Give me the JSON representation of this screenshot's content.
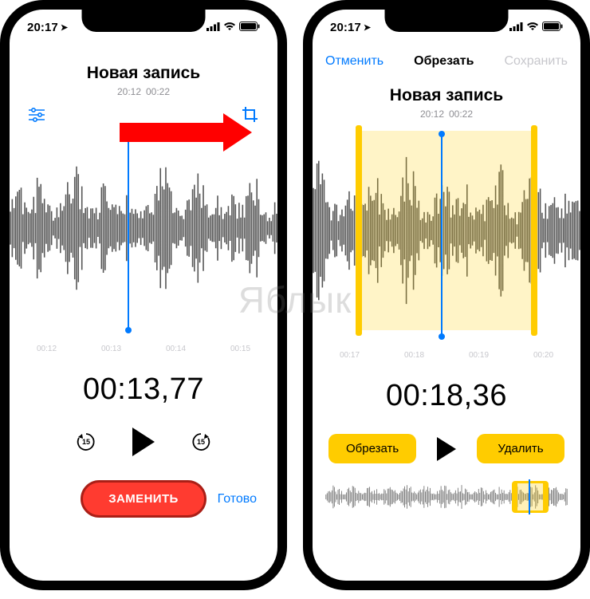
{
  "watermark": "Яблык",
  "left": {
    "status_time": "20:17",
    "title": "Новая запись",
    "rec_time": "20:12",
    "duration": "00:22",
    "ticks": [
      "00:12",
      "00:13",
      "00:14",
      "00:15"
    ],
    "timecode": "00:13,77",
    "skip_seconds": "15",
    "replace_label": "ЗАМЕНИТЬ",
    "done_label": "Готово",
    "settings_icon": "settings-icon",
    "crop_icon": "crop-icon"
  },
  "right": {
    "status_time": "20:17",
    "cancel_label": "Отменить",
    "nav_title": "Обрезать",
    "save_label": "Сохранить",
    "title": "Новая запись",
    "rec_time": "20:12",
    "duration": "00:22",
    "ticks": [
      "00:17",
      "00:18",
      "00:19",
      "00:20"
    ],
    "timecode": "00:18,36",
    "trim_label": "Обрезать",
    "delete_label": "Удалить"
  }
}
